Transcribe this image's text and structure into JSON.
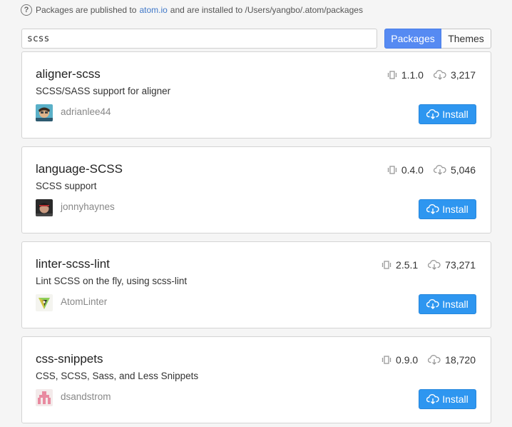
{
  "header": {
    "prefix": "Packages are published to",
    "link": "atom.io",
    "suffix": "and are installed to /Users/yangbo/.atom/packages"
  },
  "search": {
    "value": "scss"
  },
  "toggle": {
    "packages": "Packages",
    "themes": "Themes"
  },
  "packages": [
    {
      "name": "aligner-scss",
      "description": "SCSS/SASS support for aligner",
      "version": "1.1.0",
      "downloads": "3,217",
      "author": "adrianlee44",
      "install": "Install"
    },
    {
      "name": "language-SCSS",
      "description": "SCSS support",
      "version": "0.4.0",
      "downloads": "5,046",
      "author": "jonnyhaynes",
      "install": "Install"
    },
    {
      "name": "linter-scss-lint",
      "description": "Lint SCSS on the fly, using scss-lint",
      "version": "2.5.1",
      "downloads": "73,271",
      "author": "AtomLinter",
      "install": "Install"
    },
    {
      "name": "css-snippets",
      "description": "CSS, SCSS, Sass, and Less Snippets",
      "version": "0.9.0",
      "downloads": "18,720",
      "author": "dsandstrom",
      "install": "Install"
    }
  ],
  "colors": {
    "accent": "#568af2",
    "install": "#2e96f0"
  }
}
